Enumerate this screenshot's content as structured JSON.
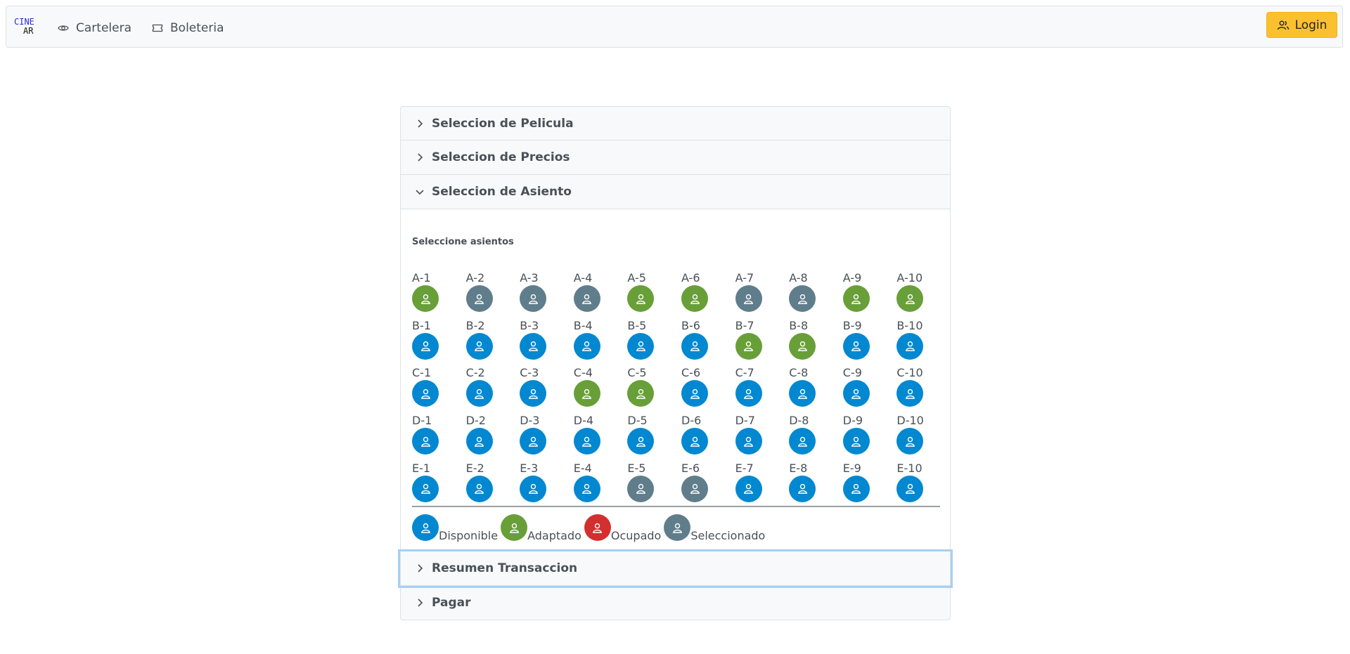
{
  "brand": {
    "line1": "CINE",
    "line2": "AR"
  },
  "nav": {
    "cartelera": "Cartelera",
    "boleteria": "Boleteria",
    "login": "Login"
  },
  "accordion": {
    "pelicula": "Seleccion de Pelicula",
    "precios": "Seleccion de Precios",
    "asiento": "Seleccion de Asiento",
    "resumen": "Resumen Transaccion",
    "pagar": "Pagar"
  },
  "seat_section": {
    "title": "Seleccione asientos",
    "rows": [
      {
        "row": "A",
        "seats": [
          "Adaptado",
          "Seleccionado",
          "Seleccionado",
          "Seleccionado",
          "Adaptado",
          "Adaptado",
          "Seleccionado",
          "Seleccionado",
          "Adaptado",
          "Adaptado"
        ]
      },
      {
        "row": "B",
        "seats": [
          "Disponible",
          "Disponible",
          "Disponible",
          "Disponible",
          "Disponible",
          "Disponible",
          "Adaptado",
          "Adaptado",
          "Disponible",
          "Disponible"
        ]
      },
      {
        "row": "C",
        "seats": [
          "Disponible",
          "Disponible",
          "Disponible",
          "Adaptado",
          "Adaptado",
          "Disponible",
          "Disponible",
          "Disponible",
          "Disponible",
          "Disponible"
        ]
      },
      {
        "row": "D",
        "seats": [
          "Disponible",
          "Disponible",
          "Disponible",
          "Disponible",
          "Disponible",
          "Disponible",
          "Disponible",
          "Disponible",
          "Disponible",
          "Disponible"
        ]
      },
      {
        "row": "E",
        "seats": [
          "Disponible",
          "Disponible",
          "Disponible",
          "Disponible",
          "Seleccionado",
          "Seleccionado",
          "Disponible",
          "Disponible",
          "Disponible",
          "Disponible"
        ]
      }
    ]
  },
  "legend": [
    {
      "label": "Disponible",
      "color": "#0288d1"
    },
    {
      "label": "Adaptado",
      "color": "#689f38"
    },
    {
      "label": "Ocupado",
      "color": "#d32f2f"
    },
    {
      "label": "Seleccionado",
      "color": "#607d8b"
    }
  ],
  "colors": {
    "Disponible": "#0288d1",
    "Adaptado": "#689f38",
    "Ocupado": "#d32f2f",
    "Seleccionado": "#607d8b",
    "login_button": "#fbc02d"
  },
  "icons": {
    "seat": "user-icon",
    "cartelera": "eye-icon",
    "boleteria": "ticket-icon",
    "login": "users-icon",
    "collapsed": "chevron-right-icon",
    "expanded": "chevron-down-icon"
  }
}
